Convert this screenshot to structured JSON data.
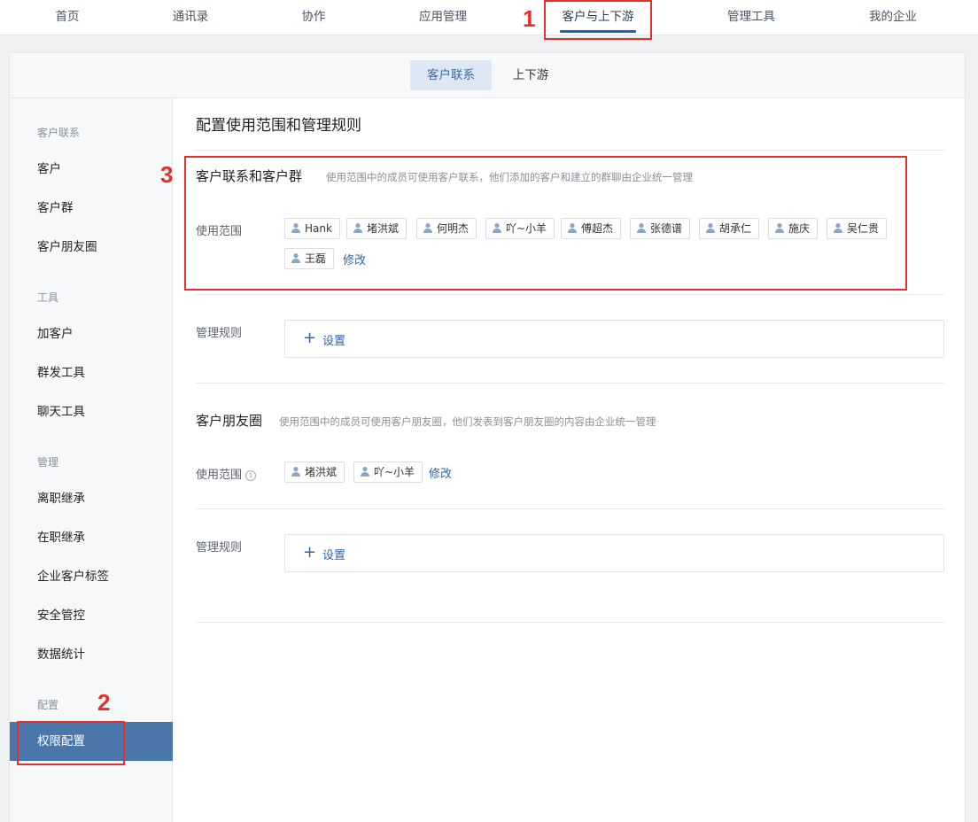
{
  "topnav": {
    "items": [
      {
        "label": "首页"
      },
      {
        "label": "通讯录"
      },
      {
        "label": "协作"
      },
      {
        "label": "应用管理"
      },
      {
        "label": "客户与上下游"
      },
      {
        "label": "管理工具"
      },
      {
        "label": "我的企业"
      }
    ],
    "active_index": 4
  },
  "subtabs": [
    {
      "label": "客户联系"
    },
    {
      "label": "上下游"
    }
  ],
  "sidebar": {
    "groups": [
      {
        "title": "客户联系",
        "items": [
          {
            "label": "客户"
          },
          {
            "label": "客户群"
          },
          {
            "label": "客户朋友圈"
          }
        ]
      },
      {
        "title": "工具",
        "items": [
          {
            "label": "加客户"
          },
          {
            "label": "群发工具"
          },
          {
            "label": "聊天工具"
          }
        ]
      },
      {
        "title": "管理",
        "items": [
          {
            "label": "离职继承"
          },
          {
            "label": "在职继承"
          },
          {
            "label": "企业客户标签"
          },
          {
            "label": "安全管控"
          },
          {
            "label": "数据统计"
          }
        ]
      },
      {
        "title": "配置",
        "items": [
          {
            "label": "权限配置"
          }
        ]
      }
    ],
    "active_item": "权限配置"
  },
  "content": {
    "page_title": "配置使用范围和管理规则",
    "section1": {
      "title": "客户联系和客户群",
      "desc": "使用范围中的成员可使用客户联系，他们添加的客户和建立的群聊由企业统一管理",
      "scope_label": "使用范围",
      "members": [
        "Hank",
        "堵洪斌",
        "何明杰",
        "吖~小羊",
        "傅超杰",
        "张德谱",
        "胡承仁",
        "施庆",
        "吴仁贵",
        "王磊"
      ],
      "edit_label": "修改",
      "rule_label": "管理规则",
      "set_label": "设置"
    },
    "section2": {
      "title": "客户朋友圈",
      "desc": "使用范围中的成员可使用客户朋友圈，他们发表到客户朋友圈的内容由企业统一管理",
      "scope_label": "使用范围",
      "members": [
        "堵洪斌",
        "吖~小羊"
      ],
      "edit_label": "修改",
      "rule_label": "管理规则",
      "set_label": "设置"
    }
  },
  "annotations": {
    "mark1": "1",
    "mark2": "2",
    "mark3": "3"
  },
  "colors": {
    "accent": "#4a76aa",
    "link": "#2f64a8",
    "annotation": "#e0322a"
  }
}
